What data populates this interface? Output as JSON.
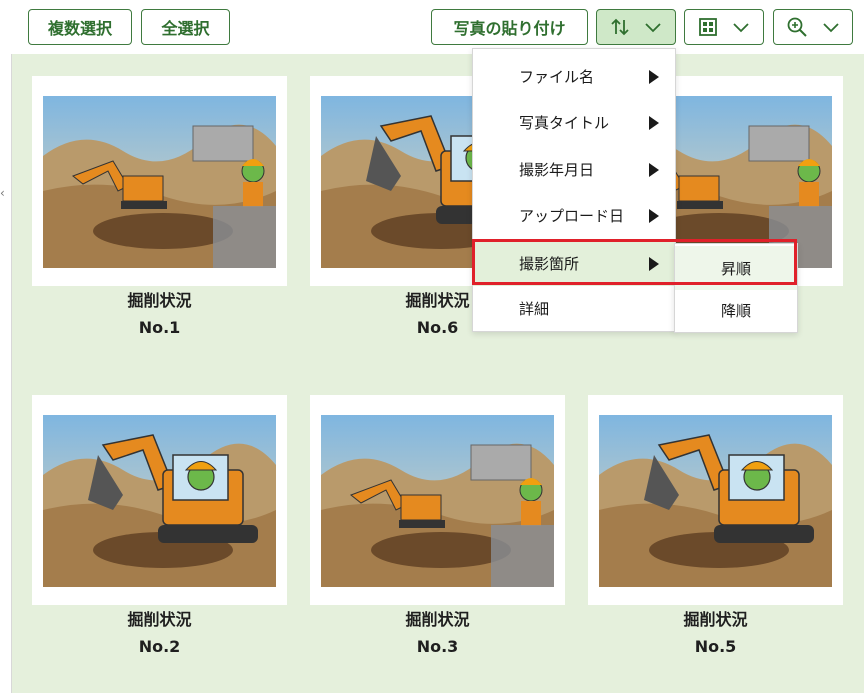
{
  "toolbar": {
    "multi_select": "複数選択",
    "select_all": "全選択",
    "paste_photo": "写真の貼り付け"
  },
  "sort_menu": {
    "items": [
      {
        "label": "ファイル名"
      },
      {
        "label": "写真タイトル"
      },
      {
        "label": "撮影年月日"
      },
      {
        "label": "アップロード日"
      },
      {
        "label": "撮影箇所"
      },
      {
        "label": "詳細"
      }
    ],
    "highlighted_index": 4,
    "submenu": {
      "ascending": "昇順",
      "descending": "降順"
    }
  },
  "photos": [
    {
      "title": "掘削状況",
      "number": "No.1",
      "scene": "wide"
    },
    {
      "title": "掘削状況",
      "number": "No.6",
      "scene": "closeup"
    },
    {
      "title": "",
      "number": "",
      "scene": "wide"
    },
    {
      "title": "掘削状況",
      "number": "No.2",
      "scene": "closeup"
    },
    {
      "title": "掘削状況",
      "number": "No.3",
      "scene": "wide"
    },
    {
      "title": "掘削状況",
      "number": "No.5",
      "scene": "closeup"
    }
  ],
  "colors": {
    "accent_green": "#3f7a3f",
    "content_bg": "#e5f0dc",
    "highlight_red": "#e0202a"
  }
}
